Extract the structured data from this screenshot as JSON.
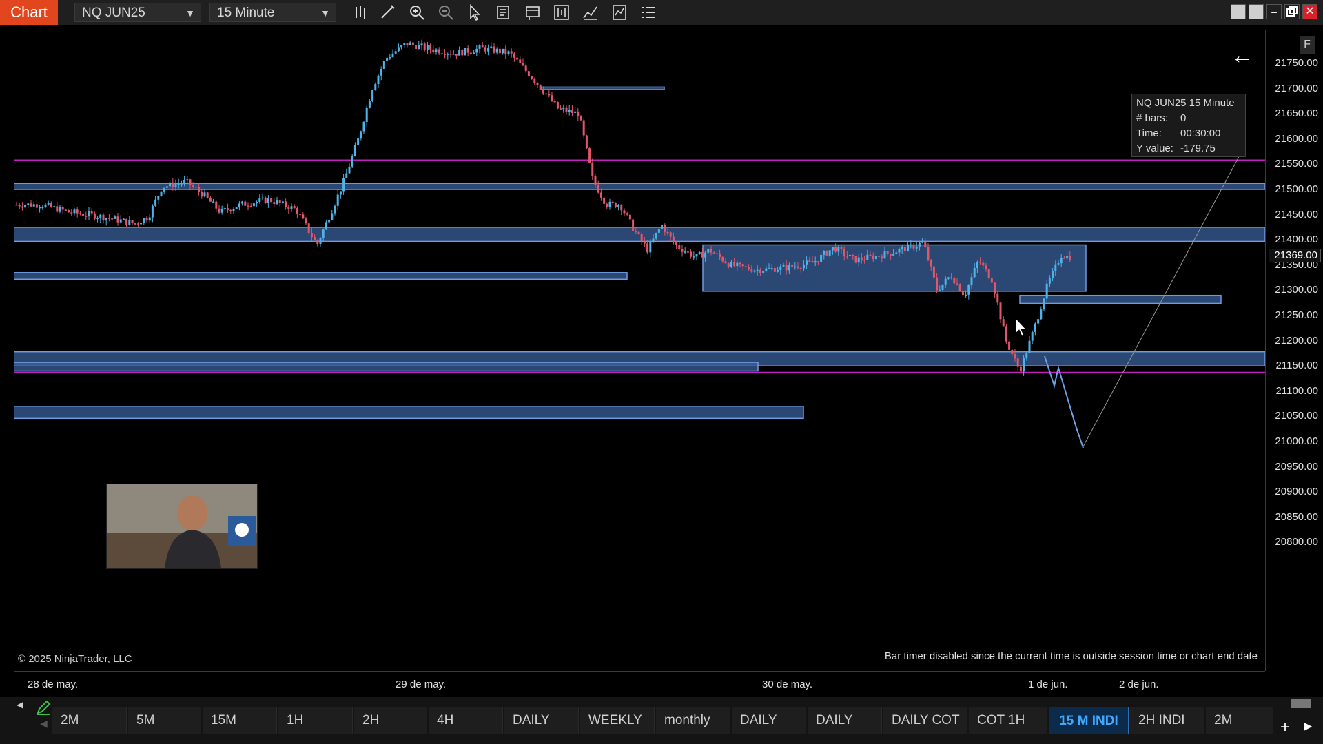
{
  "toolbar": {
    "chart_tab_label": "Chart",
    "instrument": "NQ JUN25",
    "interval": "15 Minute",
    "icons": [
      "bars-type-icon",
      "draw-pencil-icon",
      "zoom-in-icon",
      "zoom-out-icon",
      "pointer-icon",
      "properties-icon",
      "data-box-icon",
      "chart-trader-icon",
      "strategy-icon",
      "indicators-icon",
      "list-icon"
    ],
    "window_buttons": [
      "tile-icon",
      "tile2-icon",
      "minimize-icon",
      "restore-icon",
      "close-icon"
    ]
  },
  "price_axis": {
    "labels": [
      "21750.00",
      "21700.00",
      "21650.00",
      "21600.00",
      "21550.00",
      "21500.00",
      "21450.00",
      "21400.00",
      "21350.00",
      "21300.00",
      "21250.00",
      "21200.00",
      "21150.00",
      "21100.00",
      "21050.00",
      "21000.00",
      "20950.00",
      "20900.00",
      "20850.00",
      "20800.00"
    ],
    "current_price": "21369.00"
  },
  "time_axis": {
    "labels": [
      "28 de may.",
      "29 de may.",
      "30 de may.",
      "1 de jun.",
      "2 de jun."
    ]
  },
  "info_box": {
    "title": "NQ JUN25 15 Minute",
    "bars_label": "# bars:",
    "bars_value": "0",
    "time_label": "Time:",
    "time_value": "00:30:00",
    "y_label": "Y value:",
    "y_value": "-179.75"
  },
  "overlay": {
    "copyright": "© 2025 NinjaTrader, LLC",
    "bar_timer": "Bar timer disabled since the current time is outside session time or chart end date",
    "f_button": "F"
  },
  "bottom_tabs": [
    "2M",
    "5M",
    "15M",
    "1H",
    "2H",
    "4H",
    "DAILY",
    "WEEKLY",
    "monthly",
    "DAILY",
    "DAILY",
    "DAILY COT",
    "COT 1H",
    "15 M INDI",
    "2H INDI",
    "2M"
  ],
  "active_tab": "15 M INDI",
  "colors": {
    "up_candle": "#4fb3e8",
    "down_candle": "#e0566a",
    "zone_fill": "#3a5f9a",
    "magenta_line": "#c21fc2",
    "accent": "#e2461e"
  }
}
